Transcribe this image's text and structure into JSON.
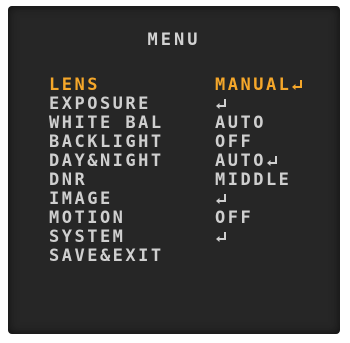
{
  "menu": {
    "title": "MENU",
    "items": [
      {
        "label": "LENS",
        "value": "MANUAL",
        "enter": true,
        "active": true
      },
      {
        "label": "EXPOSURE",
        "value": "",
        "enter": true
      },
      {
        "label": "WHITE BAL",
        "value": "AUTO",
        "enter": false
      },
      {
        "label": "BACKLIGHT",
        "value": "OFF",
        "enter": false
      },
      {
        "label": "DAY&NIGHT",
        "value": "AUTO",
        "enter": true
      },
      {
        "label": "DNR",
        "value": "MIDDLE",
        "enter": false
      },
      {
        "label": "IMAGE",
        "value": "",
        "enter": true
      },
      {
        "label": "MOTION",
        "value": "OFF",
        "enter": false
      },
      {
        "label": "SYSTEM",
        "value": "",
        "enter": true
      },
      {
        "label": "SAVE&EXIT",
        "value": "",
        "enter": false
      }
    ]
  },
  "colors": {
    "background": "#262626",
    "text": "#cfcfcf",
    "highlight": "#f5a72a"
  },
  "icons": {
    "submenu": "enter-arrow-icon"
  }
}
